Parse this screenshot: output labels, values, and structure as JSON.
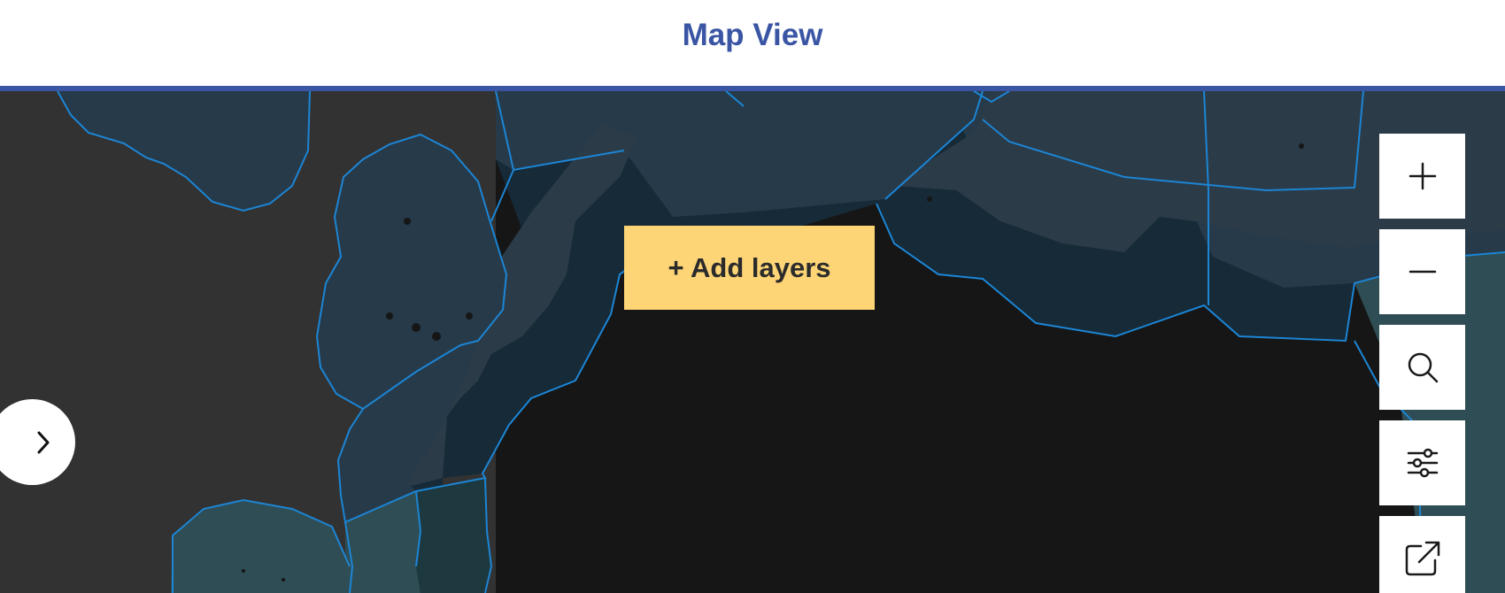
{
  "header": {
    "title": "Map View"
  },
  "map": {
    "add_layers_label": "+ Add layers",
    "panel_toggle_icon": "chevron-right-icon",
    "controls": [
      {
        "name": "zoom-in",
        "icon": "plus-icon"
      },
      {
        "name": "zoom-out",
        "icon": "minus-icon"
      },
      {
        "name": "search",
        "icon": "search-icon"
      },
      {
        "name": "filters",
        "icon": "sliders-icon"
      },
      {
        "name": "open-external",
        "icon": "external-link-icon"
      }
    ]
  },
  "colors": {
    "accent": "#3a55a4",
    "button": "#fed576",
    "land": "#323232",
    "deep_sea": "#161616",
    "zone_dark": "#162a38",
    "zone_mid": "#263a4a",
    "zone_teal": "#2f4d54",
    "border": "#1c85d4"
  }
}
